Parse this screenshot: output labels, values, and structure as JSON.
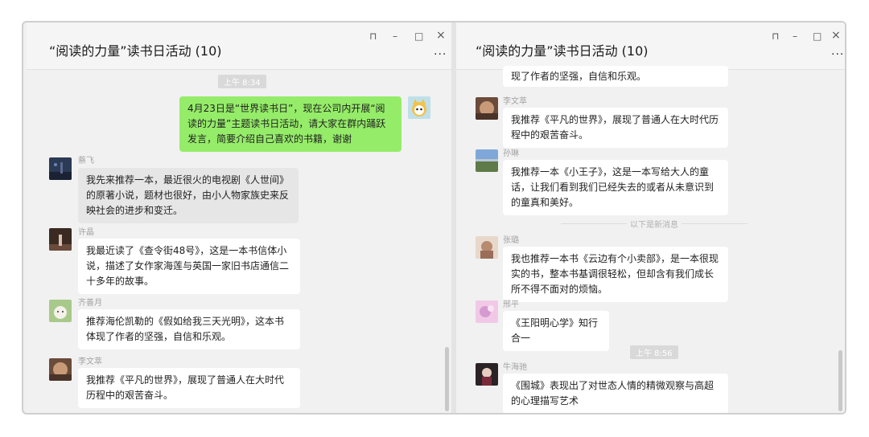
{
  "left": {
    "title": "“阅读的力量”读书日活动 (10)",
    "time": "上午 8:34",
    "self_message": "4月23日是“世界读书日”，现在公司内开展“阅读的力量”主题读书日活动，请大家在群内踊跃发言，简要介绍自己喜欢的书籍，谢谢",
    "messages": [
      {
        "name": "蔡飞",
        "text": "我先来推荐一本，最近很火的电视剧《人世间》的原著小说，题材也很好，由小人物家族史来反映社会的进步和变迁。"
      },
      {
        "name": "许晶",
        "text": "我最近读了《查令街48号》，这是一本书信体小说，描述了女作家海莲与英国一家旧书店通信二十多年的故事。"
      },
      {
        "name": "齐善月",
        "text": "推荐海伦凯勒的《假如给我三天光明》，这本书体现了作者的坚强，自信和乐观。"
      },
      {
        "name": "李文萃",
        "text": "我推荐《平凡的世界》，展现了普通人在大时代历程中的艰苦奋斗。"
      }
    ]
  },
  "right": {
    "title": "“阅读的力量”读书日活动 (10)",
    "partial_text": "现了作者的坚强，自信和乐观。",
    "new_label": "以下是新消息",
    "time2": "上午 8:56",
    "messages": [
      {
        "name": "李文萃",
        "text": "我推荐《平凡的世界》，展现了普通人在大时代历程中的艰苦奋斗。"
      },
      {
        "name": "孙琳",
        "text": "我推荐一本《小王子》，这是一本写给大人的童话，让我们看到我们已经失去的或者从未意识到的童真和美好。"
      },
      {
        "name": "张璐",
        "text": "我也推荐一本书《云边有个小卖部》，是一本很现实的书，整本书基调很轻松，但却含有我们成长所不得不面对的烦恼。"
      },
      {
        "name": "邢平",
        "text": "《王阳明心学》知行合一"
      },
      {
        "name": "牛海驰",
        "text": "《围城》表现出了对世态人情的精微观察与高超的心理描写艺术"
      }
    ]
  },
  "window_controls": {
    "pin": "⊓",
    "minimize": "–",
    "maximize": "□",
    "close": "×",
    "more": "..."
  }
}
